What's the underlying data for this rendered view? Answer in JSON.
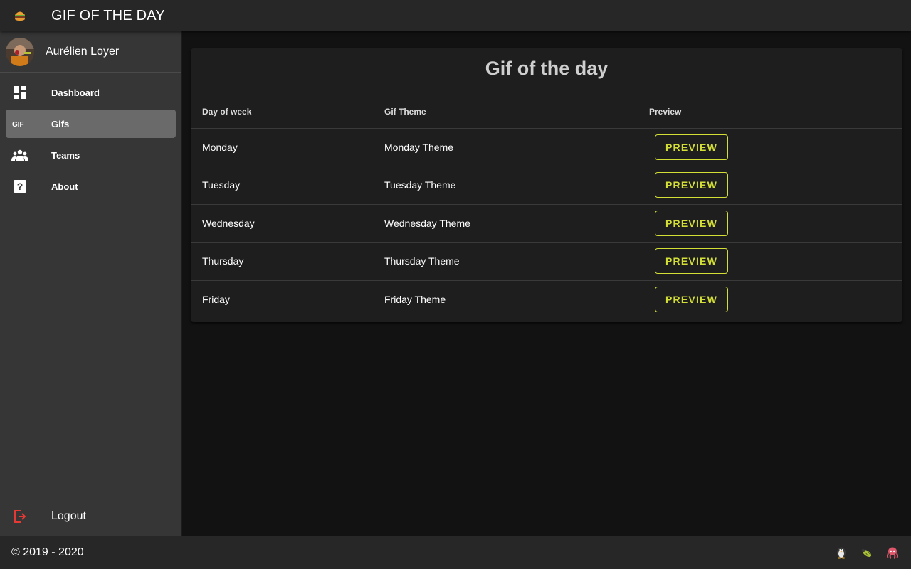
{
  "app": {
    "title": "GIF OF THE DAY"
  },
  "sidebar": {
    "user_name": "Aurélien Loyer",
    "items": [
      {
        "label": "Dashboard",
        "icon": "dashboard-icon"
      },
      {
        "label": "Gifs",
        "icon": "gif-icon",
        "active": true
      },
      {
        "label": "Teams",
        "icon": "people-icon"
      },
      {
        "label": "About",
        "icon": "help-icon"
      }
    ],
    "logout_label": "Logout"
  },
  "main": {
    "title": "Gif of the day",
    "columns": [
      "Day of week",
      "Gif Theme",
      "Preview"
    ],
    "rows": [
      {
        "day": "Monday",
        "theme": "Monday Theme",
        "action": "PREVIEW"
      },
      {
        "day": "Tuesday",
        "theme": "Tuesday Theme",
        "action": "PREVIEW"
      },
      {
        "day": "Wednesday",
        "theme": "Wednesday Theme",
        "action": "PREVIEW"
      },
      {
        "day": "Thursday",
        "theme": "Thursday Theme",
        "action": "PREVIEW"
      },
      {
        "day": "Friday",
        "theme": "Friday Theme",
        "action": "PREVIEW"
      }
    ]
  },
  "footer": {
    "copyright": "© 2019 - 2020",
    "icons": [
      "penguin-icon",
      "bug-icon",
      "octopus-icon"
    ]
  },
  "colors": {
    "accent": "#d4df36",
    "appbar": "#272727",
    "sidebar": "#363636",
    "card": "#1e1e1e",
    "background": "#121212",
    "logout_icon": "#e53935"
  }
}
